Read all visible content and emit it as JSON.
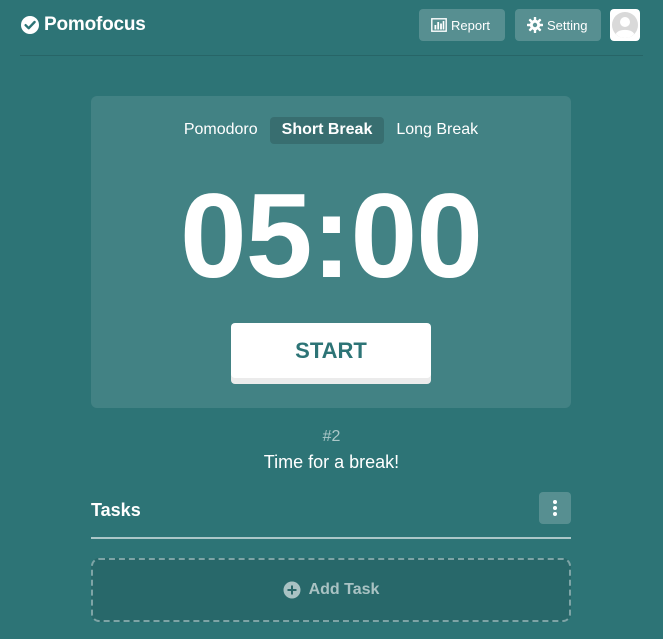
{
  "header": {
    "brand": "Pomofocus",
    "report_label": "Report",
    "setting_label": "Setting"
  },
  "timer": {
    "modes": [
      {
        "label": "Pomodoro",
        "active": false
      },
      {
        "label": "Short Break",
        "active": true
      },
      {
        "label": "Long Break",
        "active": false
      }
    ],
    "time": "05:00",
    "start_label": "START"
  },
  "status": {
    "count": "#2",
    "message": "Time for a break!"
  },
  "tasks": {
    "title": "Tasks",
    "add_label": "Add Task"
  },
  "colors": {
    "background": "#2d7476",
    "accent_text": "#2d7476"
  },
  "icons": {
    "brand": "check-circle-icon",
    "report": "bar-chart-icon",
    "setting": "gear-icon",
    "avatar": "user-avatar-icon",
    "tasks_menu": "vertical-dots-icon",
    "add": "plus-circle-icon"
  }
}
